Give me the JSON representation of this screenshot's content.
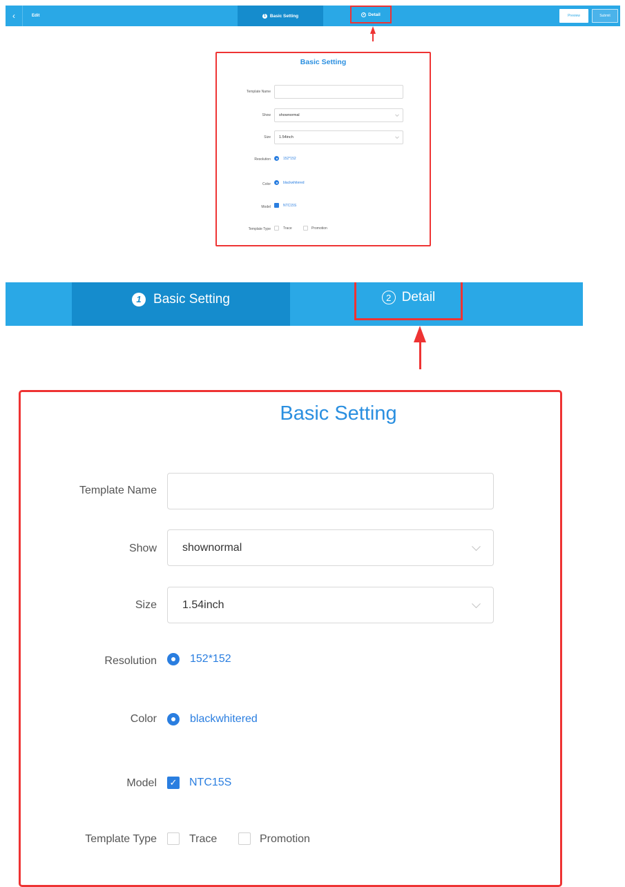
{
  "header": {
    "back_icon": "‹",
    "title": "Edit",
    "steps": [
      {
        "number": "1",
        "label": "Basic Setting"
      },
      {
        "number": "2",
        "label": "Detail"
      }
    ],
    "preview_label": "Preview",
    "submit_label": "Submit"
  },
  "form": {
    "title": "Basic Setting",
    "template_name": {
      "label": "Template Name",
      "value": ""
    },
    "show": {
      "label": "Show",
      "value": "shownormal"
    },
    "size": {
      "label": "Size",
      "value": "1.54inch"
    },
    "resolution": {
      "label": "Resolution",
      "value": "152*152"
    },
    "color": {
      "label": "Color",
      "value": "blackwhitered"
    },
    "model": {
      "label": "Model",
      "value": "NTC15S",
      "check_glyph": "✓"
    },
    "template_type": {
      "label": "Template Type",
      "options": [
        "Trace",
        "Promotion"
      ]
    }
  },
  "colors": {
    "header_blue": "#2aa8e6",
    "active_step": "#158ccd",
    "accent": "#2a7ee0",
    "highlight_red": "#e33"
  }
}
